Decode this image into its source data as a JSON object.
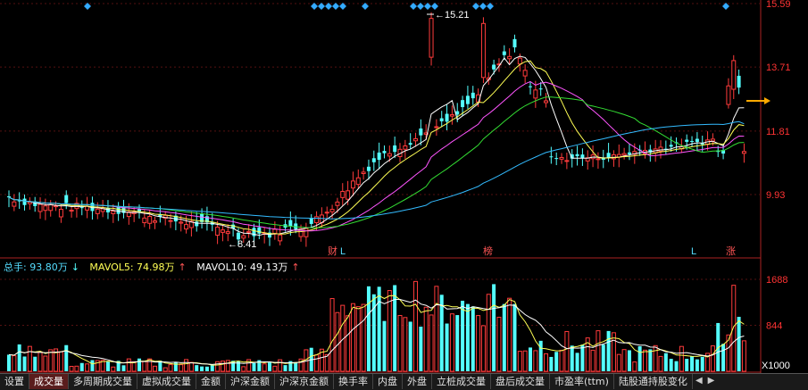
{
  "price_axis": {
    "ticks": [
      {
        "label": "15.59",
        "value": 15.59
      },
      {
        "label": "13.71",
        "value": 13.71
      },
      {
        "label": "11.81",
        "value": 11.81
      },
      {
        "label": "9.93",
        "value": 9.93
      }
    ],
    "high_label": "15.21",
    "low_label": "8.41",
    "color": "#ff3333"
  },
  "volume_axis": {
    "ticks": [
      {
        "label": "1688",
        "value": 1688
      },
      {
        "label": "844",
        "value": 844
      }
    ],
    "unit_label": "X1000"
  },
  "markers": {
    "cai": "财",
    "l1": "L",
    "bang": "榜",
    "l2": "L",
    "zhang": "涨"
  },
  "volume_legend": {
    "total": "总手: 93.80万",
    "total_arrow": "↓",
    "mavol5": "MAVOL5: 74.98万",
    "mavol5_arrow": "↑",
    "mavol10": "MAVOL10: 49.13万",
    "mavol10_arrow": "↑"
  },
  "tabs": [
    {
      "label": "设置",
      "active": false
    },
    {
      "label": "成交量",
      "active": true
    },
    {
      "label": "多周期成交量",
      "active": false
    },
    {
      "label": "虚拟成交量",
      "active": false
    },
    {
      "label": "金额",
      "active": false
    },
    {
      "label": "沪深金额",
      "active": false
    },
    {
      "label": "沪深京金额",
      "active": false
    },
    {
      "label": "换手率",
      "active": false
    },
    {
      "label": "内盘",
      "active": false
    },
    {
      "label": "外盘",
      "active": false
    },
    {
      "label": "立桩成交量",
      "active": false
    },
    {
      "label": "盘后成交量",
      "active": false
    },
    {
      "label": "市盈率(ttm)",
      "active": false
    },
    {
      "label": "陆股通持股变化",
      "active": false
    }
  ],
  "tab_arrows": {
    "left": "◀",
    "right": "▶"
  },
  "colors": {
    "up": "#ff3b3b",
    "down": "#54ffff",
    "ma5": "#ffffff",
    "ma10": "#ffff55",
    "ma20": "#ff55ff",
    "ma30": "#33dd33",
    "ma60": "#33bbff",
    "diamond": "#33aaff",
    "arrow": "#ffaa00"
  }
}
